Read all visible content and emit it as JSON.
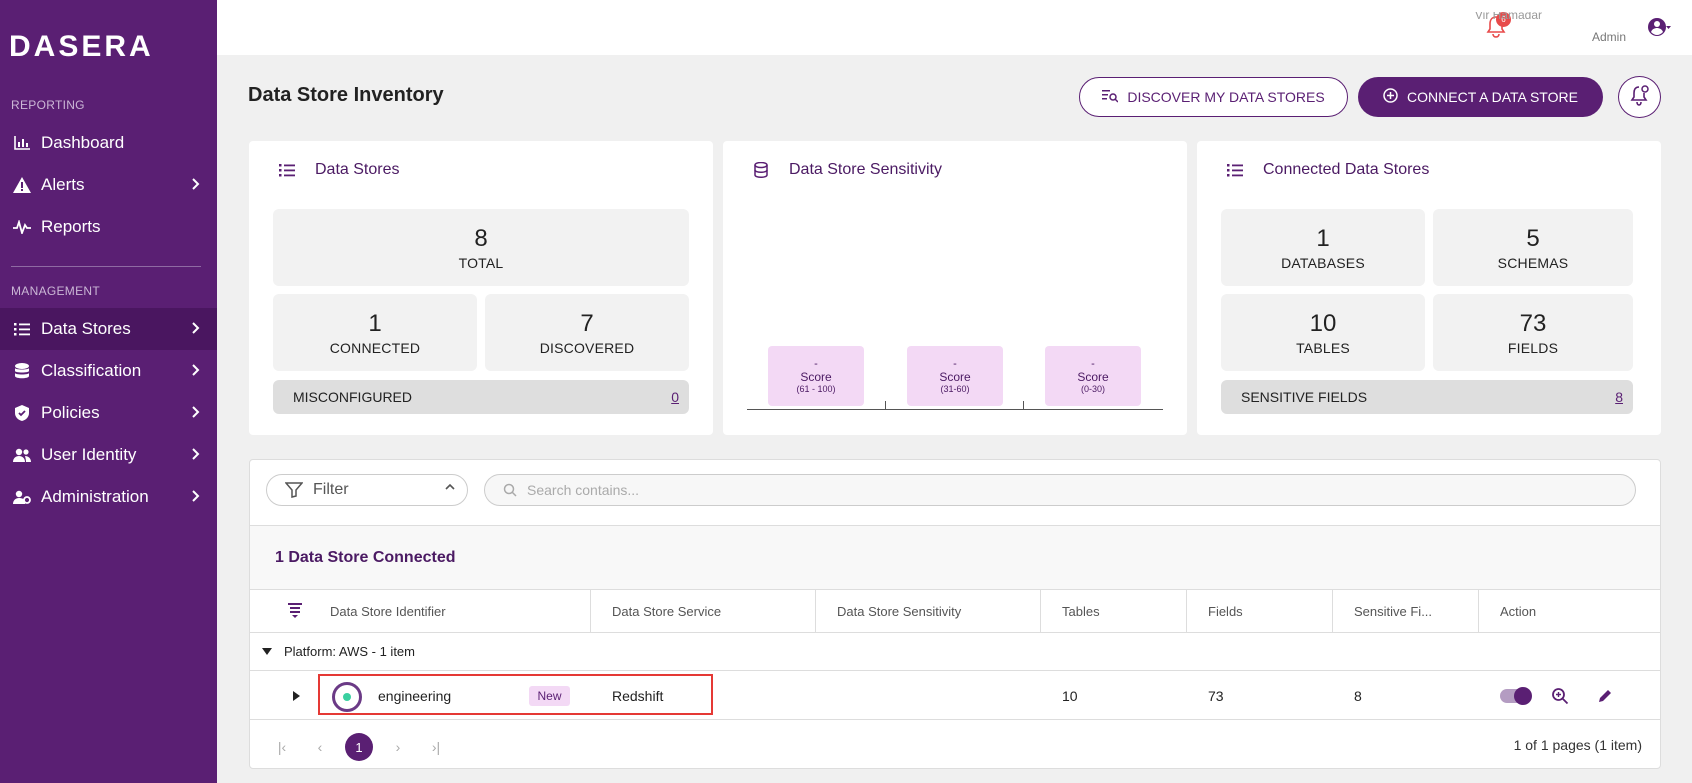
{
  "brand": {
    "logo": "DASERA"
  },
  "sidebar": {
    "reporting_label": "REPORTING",
    "management_label": "MANAGEMENT",
    "items": [
      {
        "label": "Dashboard"
      },
      {
        "label": "Alerts"
      },
      {
        "label": "Reports"
      },
      {
        "label": "Data Stores"
      },
      {
        "label": "Classification"
      },
      {
        "label": "Policies"
      },
      {
        "label": "User Identity"
      },
      {
        "label": "Administration"
      }
    ]
  },
  "header": {
    "notification_count": "6",
    "user_name": "Vir Hamadar",
    "user_role": "Admin"
  },
  "page": {
    "title": "Data Store Inventory",
    "discover_button": "DISCOVER MY DATA STORES",
    "connect_button": "CONNECT A DATA STORE"
  },
  "data_stores_card": {
    "title": "Data Stores",
    "total_value": "8",
    "total_label": "TOTAL",
    "connected_value": "1",
    "connected_label": "CONNECTED",
    "discovered_value": "7",
    "discovered_label": "DISCOVERED",
    "misconfigured_label": "MISCONFIGURED",
    "misconfigured_value": "0"
  },
  "sensitivity_card": {
    "title": "Data Store Sensitivity",
    "scores": [
      {
        "dash": "-",
        "label": "Score",
        "range": "(61 - 100)"
      },
      {
        "dash": "-",
        "label": "Score",
        "range": "(31-60)"
      },
      {
        "dash": "-",
        "label": "Score",
        "range": "(0-30)"
      }
    ]
  },
  "connected_card": {
    "title": "Connected Data Stores",
    "databases_value": "1",
    "databases_label": "DATABASES",
    "schemas_value": "5",
    "schemas_label": "SCHEMAS",
    "tables_value": "10",
    "tables_label": "TABLES",
    "fields_value": "73",
    "fields_label": "FIELDS",
    "sensitive_label": "SENSITIVE FIELDS",
    "sensitive_value": "8"
  },
  "toolbar": {
    "filter_label": "Filter",
    "search_placeholder": "Search contains..."
  },
  "table": {
    "section_title": "1 Data Store Connected",
    "columns": [
      "Data Store Identifier",
      "Data Store Service",
      "Data Store Sensitivity",
      "Tables",
      "Fields",
      "Sensitive Fi...",
      "Action"
    ],
    "group_label": "Platform: AWS - 1 item",
    "row": {
      "identifier": "engineering",
      "badge": "New",
      "service": "Redshift",
      "sensitivity": "",
      "tables": "10",
      "fields": "73",
      "sensitive_fields": "8"
    }
  },
  "pager": {
    "current_page": "1",
    "info": "1 of 1 pages (1 item)"
  }
}
